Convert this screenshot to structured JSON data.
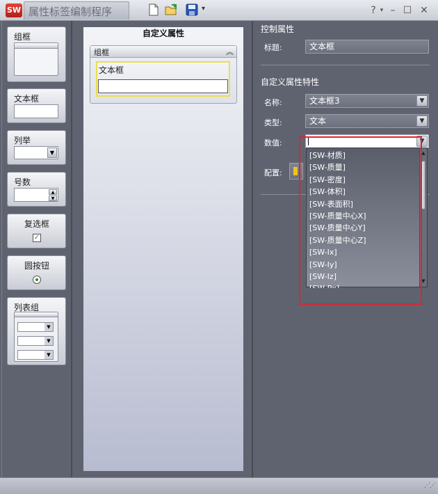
{
  "app": {
    "logo_text": "SW",
    "title": "属性标签编制程序"
  },
  "toolbar": {
    "new_icon": "new-document-icon",
    "open_icon": "open-folder-icon",
    "save_icon": "save-disk-icon",
    "save_menu_arrow": "▾"
  },
  "window_controls": {
    "help": "?",
    "help_arrow": "▾",
    "minimize": "–",
    "maximize": "☐",
    "close": "✕"
  },
  "controls_palette": {
    "items": [
      {
        "label": "组框"
      },
      {
        "label": "文本框"
      },
      {
        "label": "列举"
      },
      {
        "label": "号数"
      },
      {
        "label": "复选框"
      },
      {
        "label": "圆按钮"
      },
      {
        "label": "列表组"
      }
    ]
  },
  "canvas": {
    "title": "自定义属性",
    "group_label": "组框",
    "textbox_label": "文本框",
    "textbox_value": ""
  },
  "control_properties": {
    "heading": "控制属性",
    "title_label": "标题:",
    "title_value": "文本框"
  },
  "custom_properties": {
    "heading": "自定义属性特性",
    "name_label": "名称:",
    "name_value": "文本框3",
    "type_label": "类型:",
    "type_value": "文本",
    "value_label": "数值:",
    "value_value": "",
    "config_label": "配置:"
  },
  "value_dropdown": {
    "options": [
      "[SW-材质]",
      "[SW-质量]",
      "[SW-密度]",
      "[SW-体积]",
      "[SW-表面积]",
      "[SW-质量中心X]",
      "[SW-质量中心Y]",
      "[SW-质量中心Z]",
      "[SW-Ix]",
      "[SW-Iy]",
      "[SW-Iz]",
      "[SW-Px]"
    ]
  },
  "colors": {
    "highlight_box": "#e8202a",
    "textbox_selected_border": "#e8df50",
    "panel_bg": "#5f6370"
  }
}
